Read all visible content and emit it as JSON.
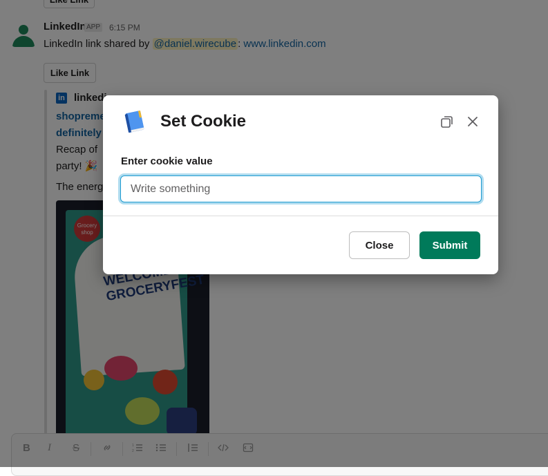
{
  "chat": {
    "prev_like_label": "Like Link",
    "sender": "LinkedIn",
    "app_badge": "APP",
    "time": "6:15 PM",
    "message_prefix": "LinkedIn link shared by",
    "mention": "@daniel.wirecube",
    "separator": ":",
    "message_link": "www.linkedin.com",
    "like_label": "Like Link",
    "unfurl": {
      "logo_letter": "in",
      "source": "linkedi",
      "title_line1": "shopreme",
      "title_line2": "definitely",
      "desc_line1": "Recap of",
      "desc_line2": "party! 🎉",
      "text2": "The energ"
    },
    "photo": {
      "badge_text": "Grocery shop",
      "sign_line1": "WELCOME",
      "sign_line2": "GROCERYFEST"
    }
  },
  "composer": {
    "bold": "B",
    "italic": "I",
    "strike": "S",
    "link_icon": "link-icon",
    "ordered_list_icon": "ordered-list-icon",
    "bullet_list_icon": "bullet-list-icon",
    "blockquote_icon": "blockquote-icon",
    "code_icon": "code-icon",
    "code_block_icon": "code-block-icon"
  },
  "modal": {
    "title": "Set Cookie",
    "icon": "book-icon",
    "field_label": "Enter cookie value",
    "input_placeholder": "Write something",
    "input_value": "",
    "close_label": "Close",
    "submit_label": "Submit",
    "colors": {
      "submit_bg": "#007a5a",
      "focus_ring": "#1d9bd1"
    }
  }
}
